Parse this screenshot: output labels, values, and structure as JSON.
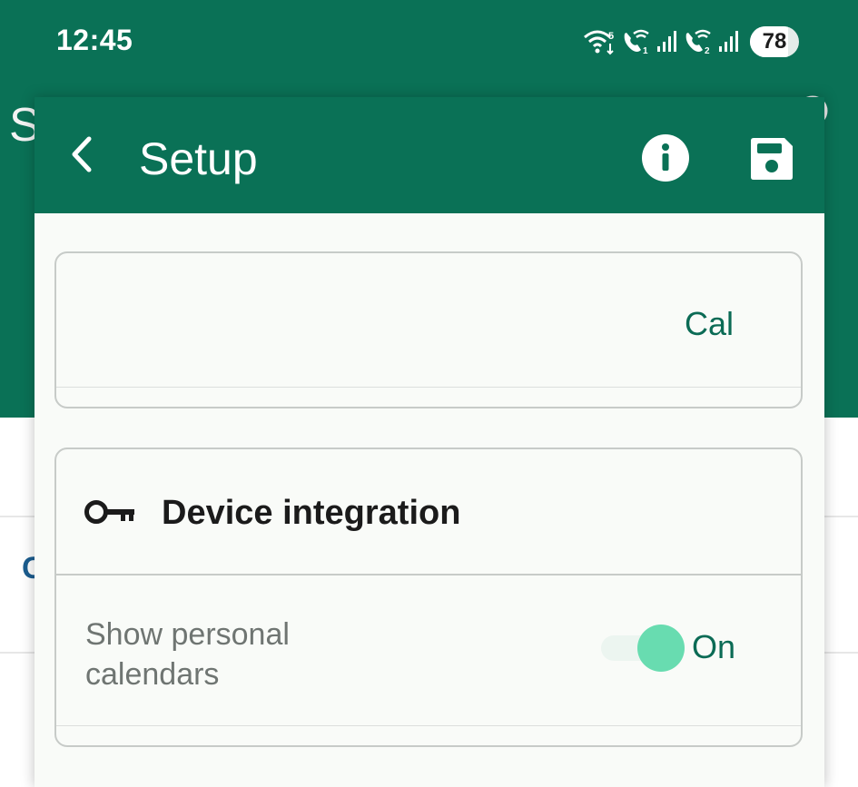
{
  "status_bar": {
    "time": "12:45",
    "battery": "78",
    "battery_level_percent": 78,
    "icons": [
      "wifi-5-icon",
      "wifi-call-sim1-icon",
      "signal-sim1-icon",
      "wifi-call-sim2-icon",
      "signal-sim2-icon",
      "battery-icon"
    ]
  },
  "background": {
    "title_fragment": "S",
    "link_fragment": "C",
    "header_color": "#0a7156"
  },
  "dialog": {
    "title": "Setup",
    "toolbar_color": "#0a7156",
    "icons": {
      "back": "back-chevron-icon",
      "info": "info-icon",
      "save": "save-floppy-icon"
    }
  },
  "calendar_card": {
    "value": "Cal"
  },
  "device_integration": {
    "title": "Device integration",
    "icon": "key-icon",
    "show_personal_calendars": {
      "label": "Show personal calendars",
      "state_label": "On",
      "enabled": true,
      "accent_color": "#68dcb0"
    }
  }
}
